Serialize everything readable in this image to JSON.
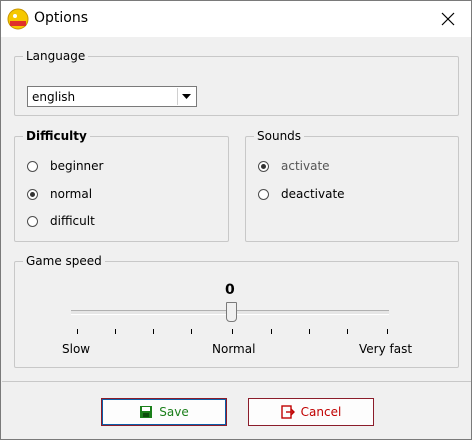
{
  "window": {
    "title": "Options",
    "icon": "app-badge-icon"
  },
  "language": {
    "legend": "Language",
    "selected": "english"
  },
  "difficulty": {
    "legend": "Difficulty",
    "options": [
      {
        "label": "beginner",
        "checked": false
      },
      {
        "label": "normal",
        "checked": true
      },
      {
        "label": "difficult",
        "checked": false
      }
    ]
  },
  "sounds": {
    "legend": "Sounds",
    "options": [
      {
        "label": "activate",
        "checked": true
      },
      {
        "label": "deactivate",
        "checked": false
      }
    ]
  },
  "game_speed": {
    "legend": "Game speed",
    "value": "0",
    "position_fraction": 0.5,
    "labels": {
      "slow": "Slow",
      "normal": "Normal",
      "fast": "Very fast"
    }
  },
  "buttons": {
    "save": "Save",
    "cancel": "Cancel"
  },
  "colors": {
    "save_text": "#1a7f1a",
    "cancel_text": "#c00000",
    "button_border": "#8b1c2a",
    "focus": "#0c5ea8"
  }
}
